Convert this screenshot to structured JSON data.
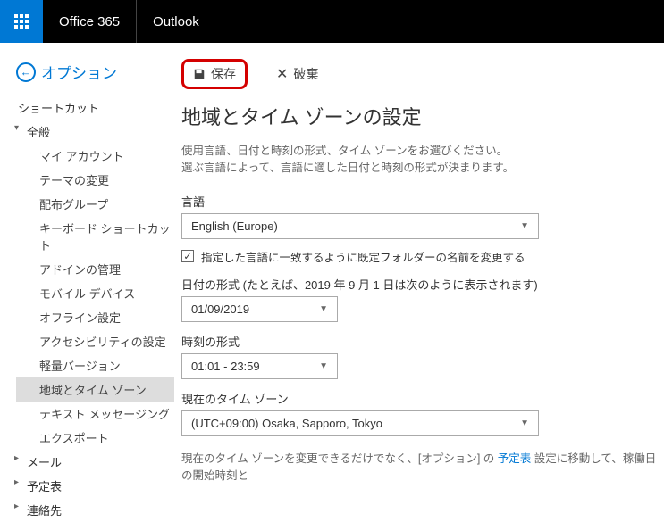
{
  "header": {
    "brand": "Office 365",
    "app": "Outlook"
  },
  "back_label": "オプション",
  "sidebar": {
    "shortcut": "ショートカット",
    "general": "全般",
    "general_items": [
      "マイ アカウント",
      "テーマの変更",
      "配布グループ",
      "キーボード ショートカット",
      "アドインの管理",
      "モバイル デバイス",
      "オフライン設定",
      "アクセシビリティの設定",
      "軽量バージョン",
      "地域とタイム ゾーン",
      "テキスト メッセージング",
      "エクスポート"
    ],
    "mail": "メール",
    "calendar": "予定表",
    "contacts": "連絡先"
  },
  "toolbar": {
    "save": "保存",
    "discard": "破棄"
  },
  "page": {
    "title": "地域とタイム ゾーンの設定",
    "desc1": "使用言語、日付と時刻の形式、タイム ゾーンをお選びください。",
    "desc2": "選ぶ言語によって、言語に適した日付と時刻の形式が決まります。"
  },
  "fields": {
    "language_label": "言語",
    "language_value": "English (Europe)",
    "rename_folder_checkbox": "指定した言語に一致するように既定フォルダーの名前を変更する",
    "rename_folder_checked": true,
    "date_format_label": "日付の形式 (たとえば、2019 年 9 月 1 日は次のように表示されます)",
    "date_format_value": "01/09/2019",
    "time_format_label": "時刻の形式",
    "time_format_value": "01:01 - 23:59",
    "timezone_label": "現在のタイム ゾーン",
    "timezone_value": "(UTC+09:00) Osaka, Sapporo, Tokyo"
  },
  "footer": {
    "part1": "現在のタイム ゾーンを変更できるだけでなく、[オプション] の ",
    "link": "予定表",
    "part2": " 設定に移動して、稼働日の開始時刻と"
  }
}
